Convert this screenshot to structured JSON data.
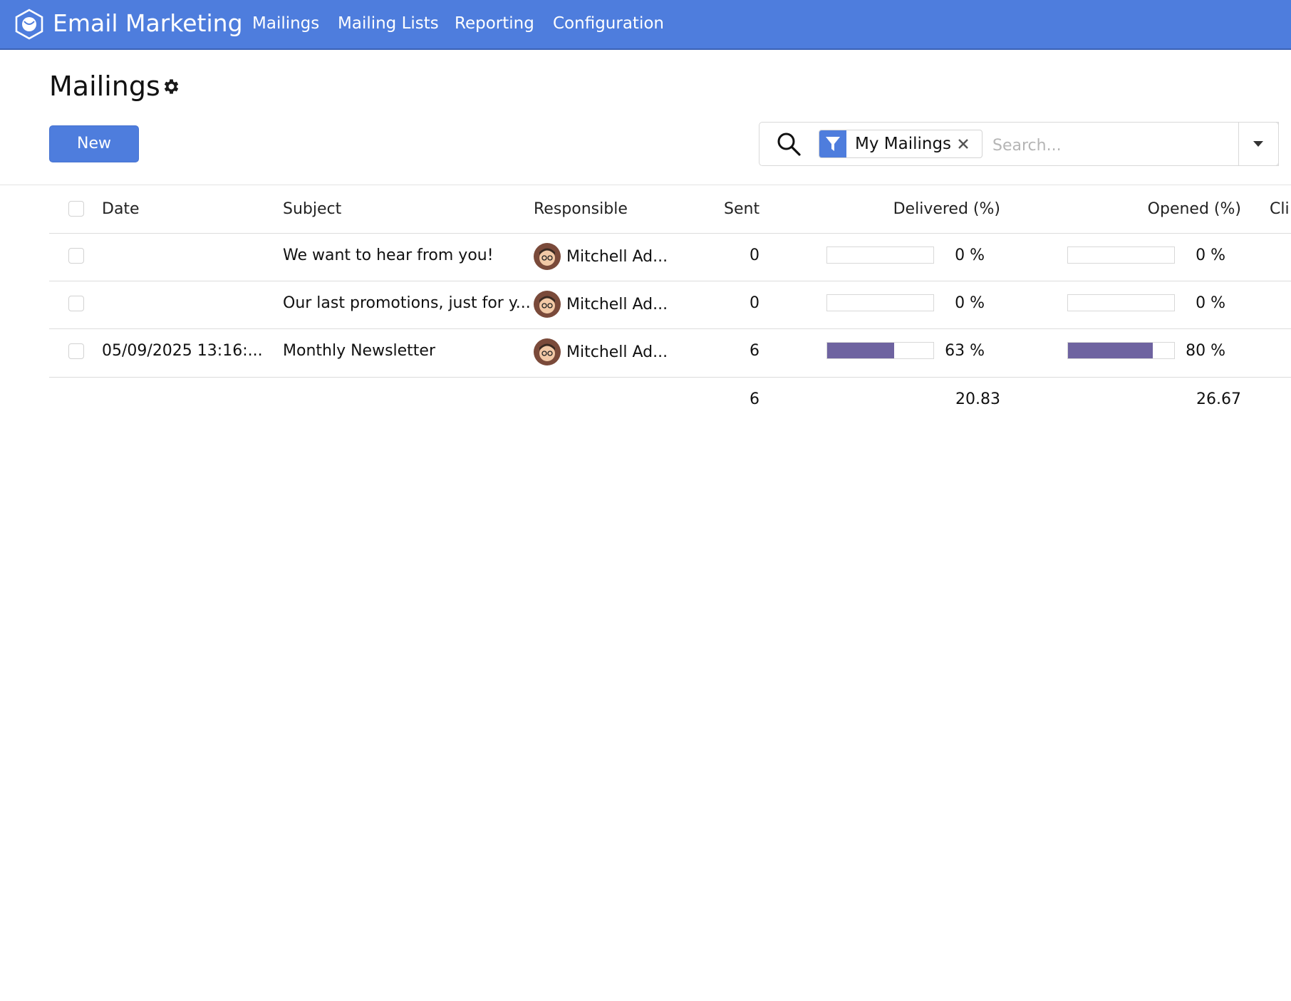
{
  "app": {
    "title": "Email Marketing",
    "accent_color": "#4e7ddd",
    "nav": [
      "Mailings",
      "Mailing Lists",
      "Reporting",
      "Configuration"
    ]
  },
  "page": {
    "title": "Mailings",
    "new_label": "New"
  },
  "search": {
    "facet_label": "My Mailings",
    "placeholder": "Search..."
  },
  "table": {
    "columns": [
      "Date",
      "Subject",
      "Responsible",
      "Sent",
      "Delivered (%)",
      "Opened (%)",
      "Cli"
    ],
    "rows": [
      {
        "date": "",
        "subject": "We want to hear from you!",
        "responsible": "Mitchell Ad...",
        "sent": "0",
        "delivered": 0,
        "delivered_label": "0 %",
        "opened": 0,
        "opened_label": "0 %"
      },
      {
        "date": "",
        "subject": "Our last promotions, just for y...",
        "responsible": "Mitchell Ad...",
        "sent": "0",
        "delivered": 0,
        "delivered_label": "0 %",
        "opened": 0,
        "opened_label": "0 %"
      },
      {
        "date": "05/09/2025 13:16:...",
        "subject": "Monthly Newsletter",
        "responsible": "Mitchell Ad...",
        "sent": "6",
        "delivered": 63,
        "delivered_label": "63 %",
        "opened": 80,
        "opened_label": "80 %"
      }
    ],
    "totals": {
      "sent": "6",
      "delivered": "20.83",
      "opened": "26.67"
    },
    "bar_color": "#6e63a0"
  }
}
